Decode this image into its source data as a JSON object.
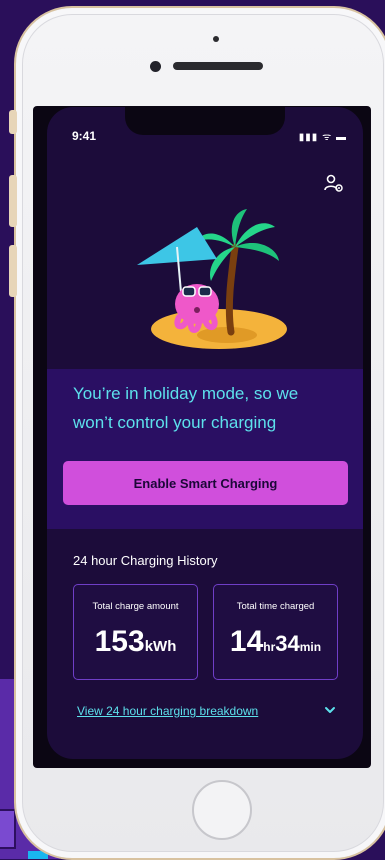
{
  "status_bar": {
    "time": "9:41",
    "icons": "▮▮▮ ᯤ ▬"
  },
  "holiday": {
    "message": "You’re in holiday mode, so we won’t control your charging"
  },
  "actions": {
    "enable_label": "Enable Smart Charging"
  },
  "history": {
    "title": "24 hour Charging History",
    "total_charge": {
      "label": "Total charge amount",
      "value": "153",
      "unit": "kWh"
    },
    "total_time": {
      "label": "Total time charged",
      "hours": "14",
      "hr_unit": "hr",
      "minutes": "34",
      "min_unit": "min"
    },
    "link_label": "View 24 hour charging breakdown"
  },
  "colors": {
    "accent_button": "#d04fdc",
    "highlight_text": "#5de1ec",
    "background": "#1c0c3a"
  },
  "icons": [
    "profile-settings-icon",
    "chevron-down-icon",
    "holiday-illustration"
  ]
}
